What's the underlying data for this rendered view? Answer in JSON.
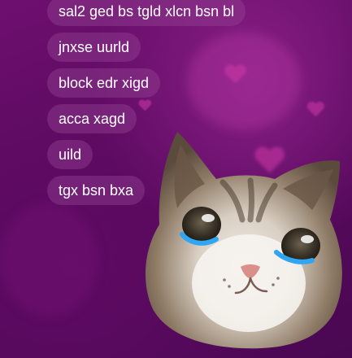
{
  "messages": [
    {
      "text": "sal2 ged bs tgld xlcn bsn bl"
    },
    {
      "text": "jnxse uurld"
    },
    {
      "text": "block edr xigd"
    },
    {
      "text": "acca xagd"
    },
    {
      "text": "uild"
    },
    {
      "text": "tgx bsn bxa"
    }
  ],
  "sticker": {
    "icon": "crying-cat-sticker"
  },
  "colors": {
    "background": "#5a0a5f",
    "bubble": "#7a3a80",
    "tears": "#2ea6f2"
  }
}
